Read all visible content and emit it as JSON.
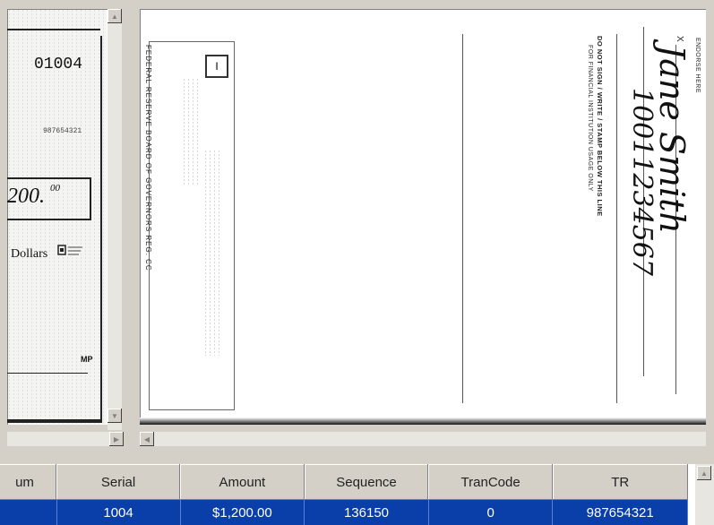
{
  "left_check": {
    "check_number": "01004",
    "routing_fragment": "987654321",
    "amount": "200.",
    "cents": "00",
    "dollars_word": "Dollars",
    "initials": "MP"
  },
  "right_check": {
    "endorse_header": "ENDORSE HERE",
    "endorse_x": "X",
    "signature": "Jane Smith",
    "account_handwritten": "10011234567",
    "warning_line": "DO NOT SIGN / WRITE / STAMP BELOW THIS LINE",
    "warning_subline": "FOR FINANCIAL INSTITUTION USAGE ONLY",
    "fed_line": "FEDERAL RESERVE BOARD OF GOVERNORS REG. CC",
    "stamp_mark": "I"
  },
  "grid": {
    "columns": [
      "um",
      "Serial",
      "Amount",
      "Sequence",
      "TranCode",
      "TR"
    ],
    "rows": [
      {
        "c0": "",
        "serial": "1004",
        "amount": "$1,200.00",
        "sequence": "136150",
        "trancode": "0",
        "tr": "987654321"
      }
    ]
  },
  "icons": {
    "scroll_up": "scroll-up-arrow-icon",
    "scroll_down": "scroll-down-arrow-icon",
    "scroll_left": "scroll-left-arrow-icon",
    "scroll_right": "scroll-right-arrow-icon"
  }
}
